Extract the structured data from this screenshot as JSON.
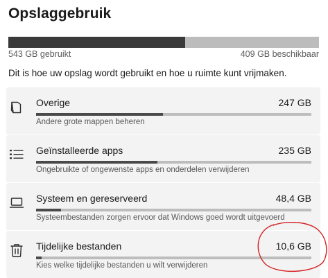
{
  "page": {
    "title": "Opslaggebruik",
    "description": "Dit is hoe uw opslag wordt gebruikt en hoe u ruimte kunt vrijmaken."
  },
  "storage": {
    "used_label": "543 GB gebruikt",
    "available_label": "409 GB beschikbaar",
    "used_fraction": 0.57
  },
  "categories": [
    {
      "name": "Overige",
      "size": "247 GB",
      "subtitle": "Andere grote mappen beheren",
      "usage_fraction": 0.46,
      "icon": "folder-icon"
    },
    {
      "name": "Geïnstalleerde apps",
      "size": "235 GB",
      "subtitle": "Ongebruikte of ongewenste apps en onderdelen verwijderen",
      "usage_fraction": 0.44,
      "icon": "apps-list-icon"
    },
    {
      "name": "Systeem en gereserveerd",
      "size": "48,4 GB",
      "subtitle": "Systeembestanden zorgen ervoor dat Windows goed wordt uitgevoerd",
      "usage_fraction": 0.09,
      "icon": "laptop-icon"
    },
    {
      "name": "Tijdelijke bestanden",
      "size": "10,6 GB",
      "subtitle": "Kies welke tijdelijke bestanden u wilt verwijderen",
      "usage_fraction": 0.02,
      "icon": "trash-icon"
    }
  ],
  "colors": {
    "bar_fill": "#3a3a3a",
    "bar_track": "#bcbcbc",
    "card_background": "#f3f3f3",
    "annotation": "#d42020"
  }
}
